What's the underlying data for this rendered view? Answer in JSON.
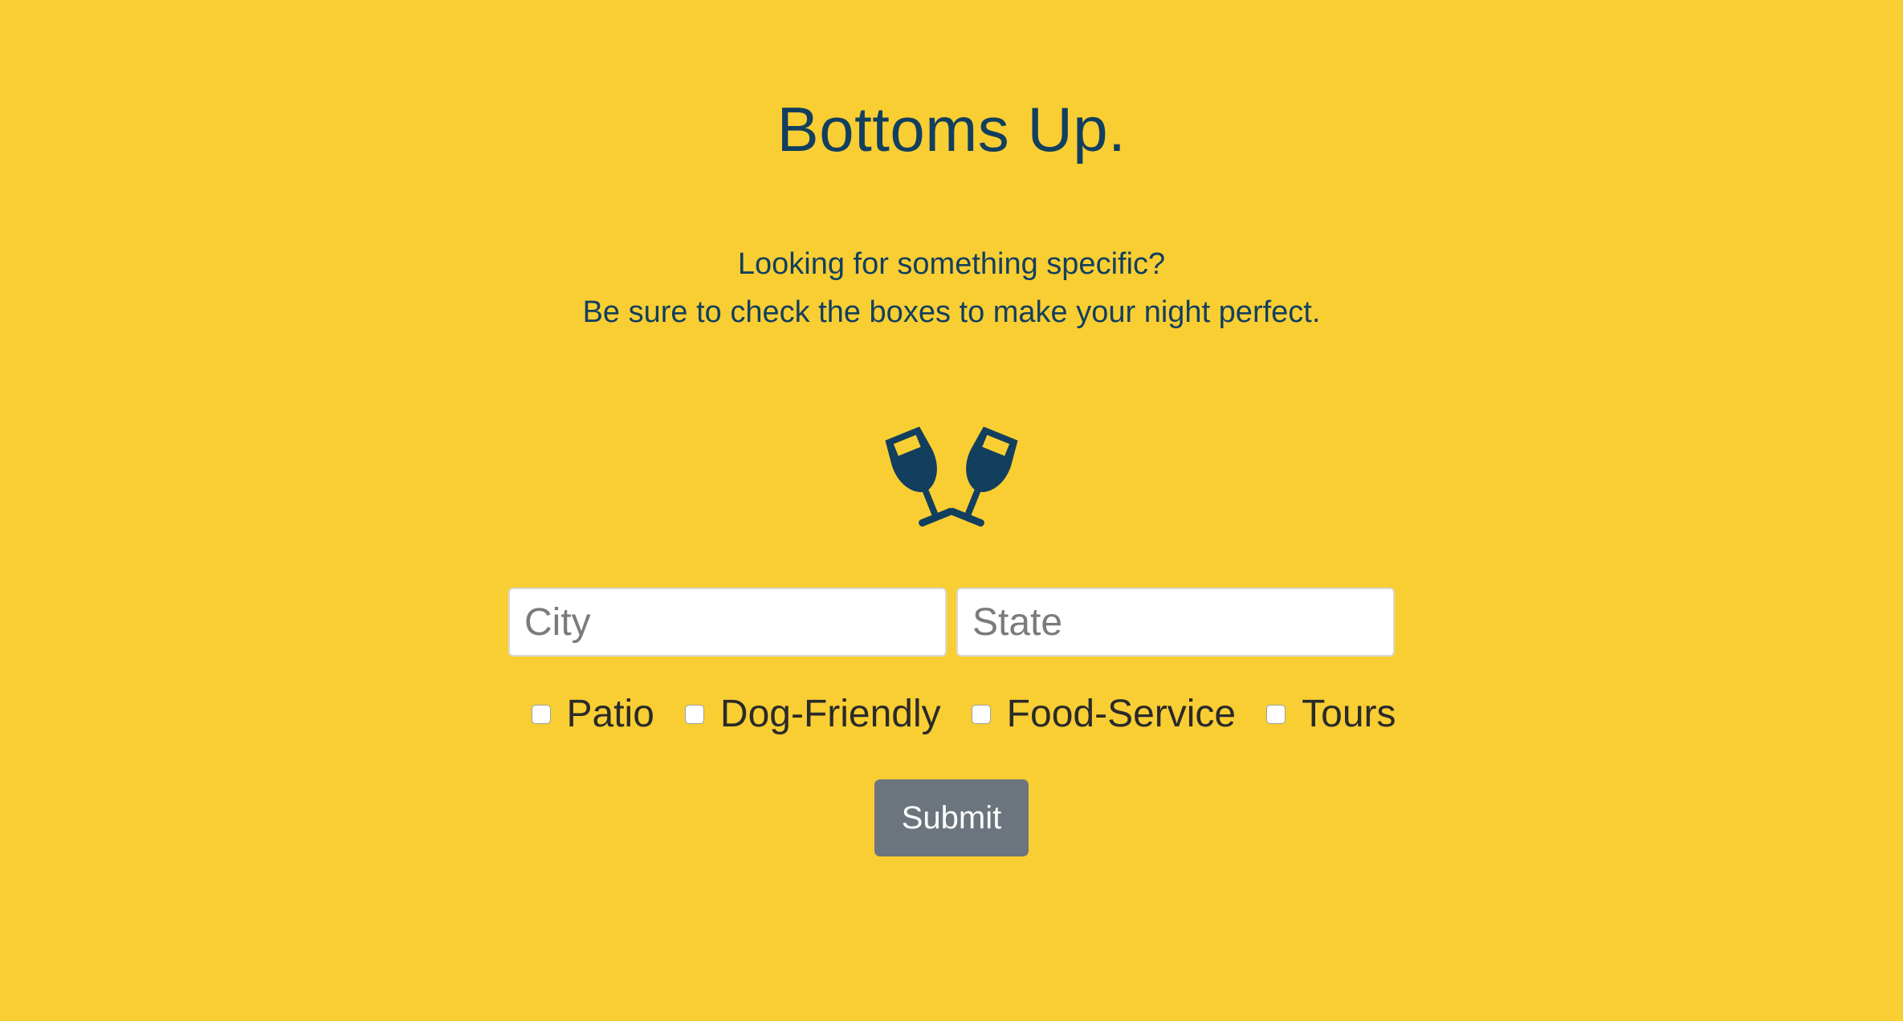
{
  "page": {
    "title": "Bottoms Up.",
    "subtitle_line1": "Looking for something specific?",
    "subtitle_line2": "Be sure to check the boxes to make your night perfect."
  },
  "icon": "wine-glasses-cheers-icon",
  "form": {
    "city": {
      "placeholder": "City",
      "value": ""
    },
    "state": {
      "placeholder": "State",
      "value": ""
    },
    "checkboxes": [
      {
        "label": "Patio",
        "checked": false
      },
      {
        "label": "Dog-Friendly",
        "checked": false
      },
      {
        "label": "Food-Service",
        "checked": false
      },
      {
        "label": "Tours",
        "checked": false
      }
    ],
    "submit_label": "Submit"
  },
  "colors": {
    "background": "#f9ce33",
    "text": "#123f5e",
    "button": "#6c757d"
  }
}
